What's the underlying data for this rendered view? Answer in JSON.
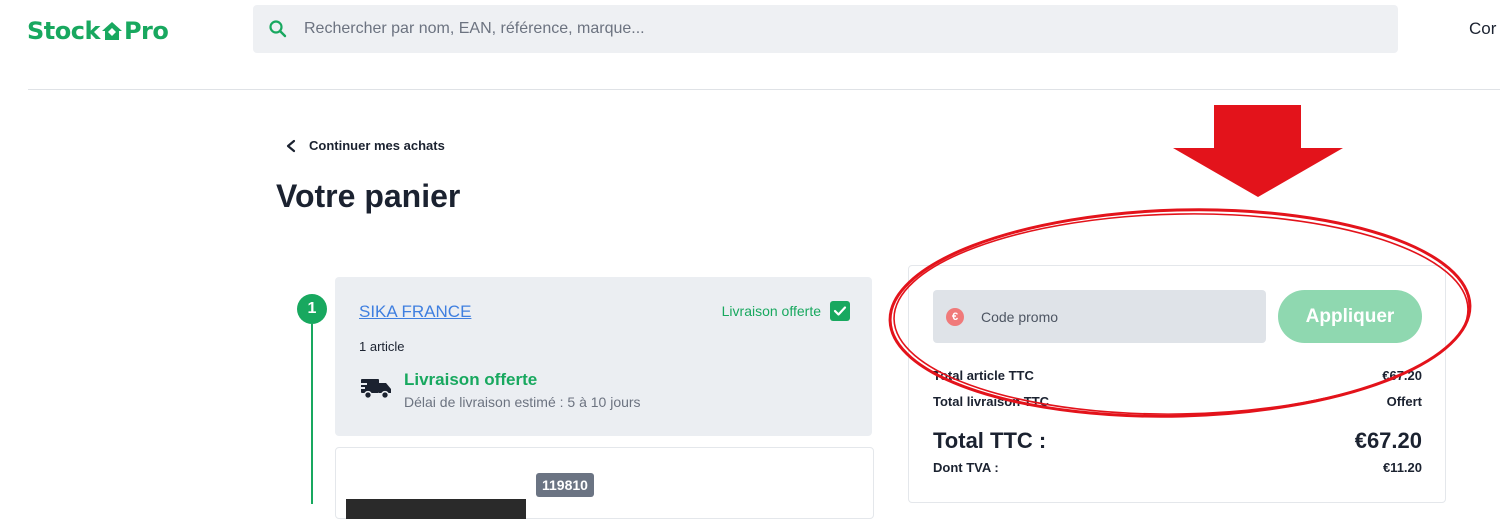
{
  "header": {
    "logo_left": "Stock",
    "logo_right": "Pro",
    "search_placeholder": "Rechercher par nom, EAN, référence, marque...",
    "account_label": "Cor"
  },
  "cart": {
    "back_label": "Continuer mes achats",
    "title": "Votre panier",
    "step_number": "1",
    "seller": {
      "name": "SIKA FRANCE",
      "free_delivery_label": "Livraison offerte",
      "free_delivery_checked": true,
      "article_count": "1 article",
      "delivery_title": "Livraison offerte",
      "delivery_delay": "Délai de livraison estimé : 5 à 10 jours"
    },
    "product": {
      "reference": "119810"
    }
  },
  "summary": {
    "promo_placeholder": "Code promo",
    "apply_label": "Appliquer",
    "rows": [
      {
        "label": "Total article TTC",
        "value": "€67.20"
      },
      {
        "label": "Total livraison TTC",
        "value": "Offert"
      }
    ],
    "total_label": "Total TTC :",
    "total_value": "€67.20",
    "tva_label": "Dont TVA :",
    "tva_value": "€11.20"
  },
  "colors": {
    "brand_green": "#18a85f",
    "annotation_red": "#e3131b",
    "apply_button": "#8fd8b0"
  }
}
